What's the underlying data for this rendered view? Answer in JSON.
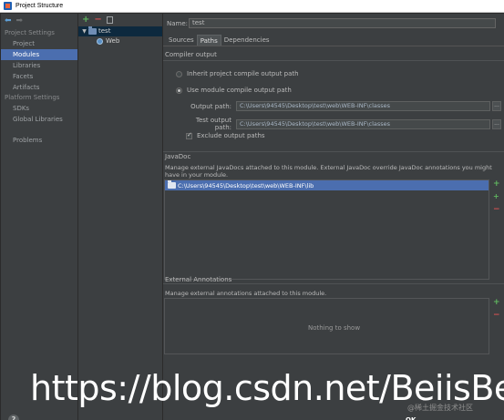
{
  "window": {
    "title": "Project Structure"
  },
  "nav": {
    "sections": [
      {
        "title": "Project Settings",
        "items": [
          {
            "label": "Project",
            "selected": false
          },
          {
            "label": "Modules",
            "selected": true
          },
          {
            "label": "Libraries",
            "selected": false
          },
          {
            "label": "Facets",
            "selected": false
          },
          {
            "label": "Artifacts",
            "selected": false
          }
        ]
      },
      {
        "title": "Platform Settings",
        "items": [
          {
            "label": "SDKs",
            "selected": false
          },
          {
            "label": "Global Libraries",
            "selected": false
          }
        ]
      }
    ],
    "problems_label": "Problems"
  },
  "tree": {
    "module": "test",
    "facet": "Web"
  },
  "main": {
    "name_label": "Name:",
    "name_value": "test",
    "tabs": [
      "Sources",
      "Paths",
      "Dependencies"
    ],
    "active_tab": "Paths",
    "compiler_output": {
      "title": "Compiler output",
      "inherit_label": "Inherit project compile output path",
      "module_label": "Use module compile output path",
      "selected": "module",
      "output_label": "Output path:",
      "output_value": "C:\\Users\\94545\\Desktop\\test\\web\\WEB-INF\\classes",
      "test_label": "Test output path:",
      "test_value": "C:\\Users\\94545\\Desktop\\test\\web\\WEB-INF\\classes",
      "exclude_label": "Exclude output paths",
      "exclude_checked": true
    },
    "javadoc": {
      "title": "JavaDoc",
      "description": "Manage external JavaDocs attached to this module. External JavaDoc override JavaDoc annotations you might have in your module.",
      "entries": [
        "C:\\Users\\94545\\Desktop\\test\\web\\WEB-INF\\lib"
      ]
    },
    "external_annotations": {
      "title": "External Annotations",
      "description": "Manage external annotations attached to this module.",
      "empty_text": "Nothing to show"
    }
  },
  "footer": {
    "help": "?",
    "ok": "OK"
  },
  "overlay": {
    "watermark": "https://blog.csdn.net/BeiisBei",
    "small_watermark": "@稀土掘金技术社区"
  }
}
